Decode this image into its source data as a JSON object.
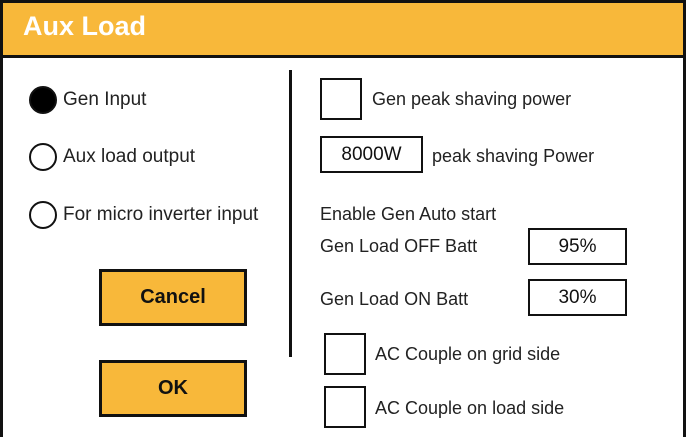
{
  "title": "Aux Load",
  "modes": [
    {
      "label": "Gen Input",
      "selected": true
    },
    {
      "label": "Aux load output",
      "selected": false
    },
    {
      "label": "For micro inverter input",
      "selected": false
    }
  ],
  "buttons": {
    "cancel": "Cancel",
    "ok": "OK"
  },
  "gen_peak_shaving": {
    "label": "Gen peak shaving power",
    "checked": false
  },
  "peak_shaving_power": {
    "value": "8000W",
    "label": "peak shaving Power"
  },
  "auto_start": {
    "heading": "Enable Gen Auto start",
    "load_off_label": "Gen Load OFF Batt",
    "load_off_value": "95%",
    "load_on_label": "Gen Load ON Batt",
    "load_on_value": "30%"
  },
  "ac_couple_grid": {
    "label": "AC Couple on grid side",
    "checked": false
  },
  "ac_couple_load": {
    "label": "AC Couple on load side",
    "checked": false
  },
  "colors": {
    "accent": "#f8b83a",
    "border": "#111111",
    "title_text": "#ffffff"
  }
}
